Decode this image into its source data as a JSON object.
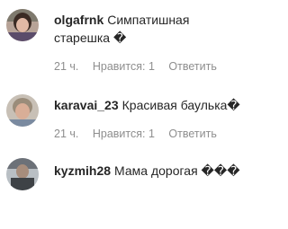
{
  "comments": [
    {
      "username": "olgafrnk",
      "text": "Симпатишная старешка �",
      "time": "21 ч.",
      "likes": "Нравится: 1",
      "reply": "Ответить"
    },
    {
      "username": "karavai_23",
      "text": "Красивая баулька�",
      "time": "21 ч.",
      "likes": "Нравится: 1",
      "reply": "Ответить"
    },
    {
      "username": "kyzmih28",
      "text": "Мама дорогая ���",
      "time": "",
      "likes": "",
      "reply": ""
    }
  ]
}
